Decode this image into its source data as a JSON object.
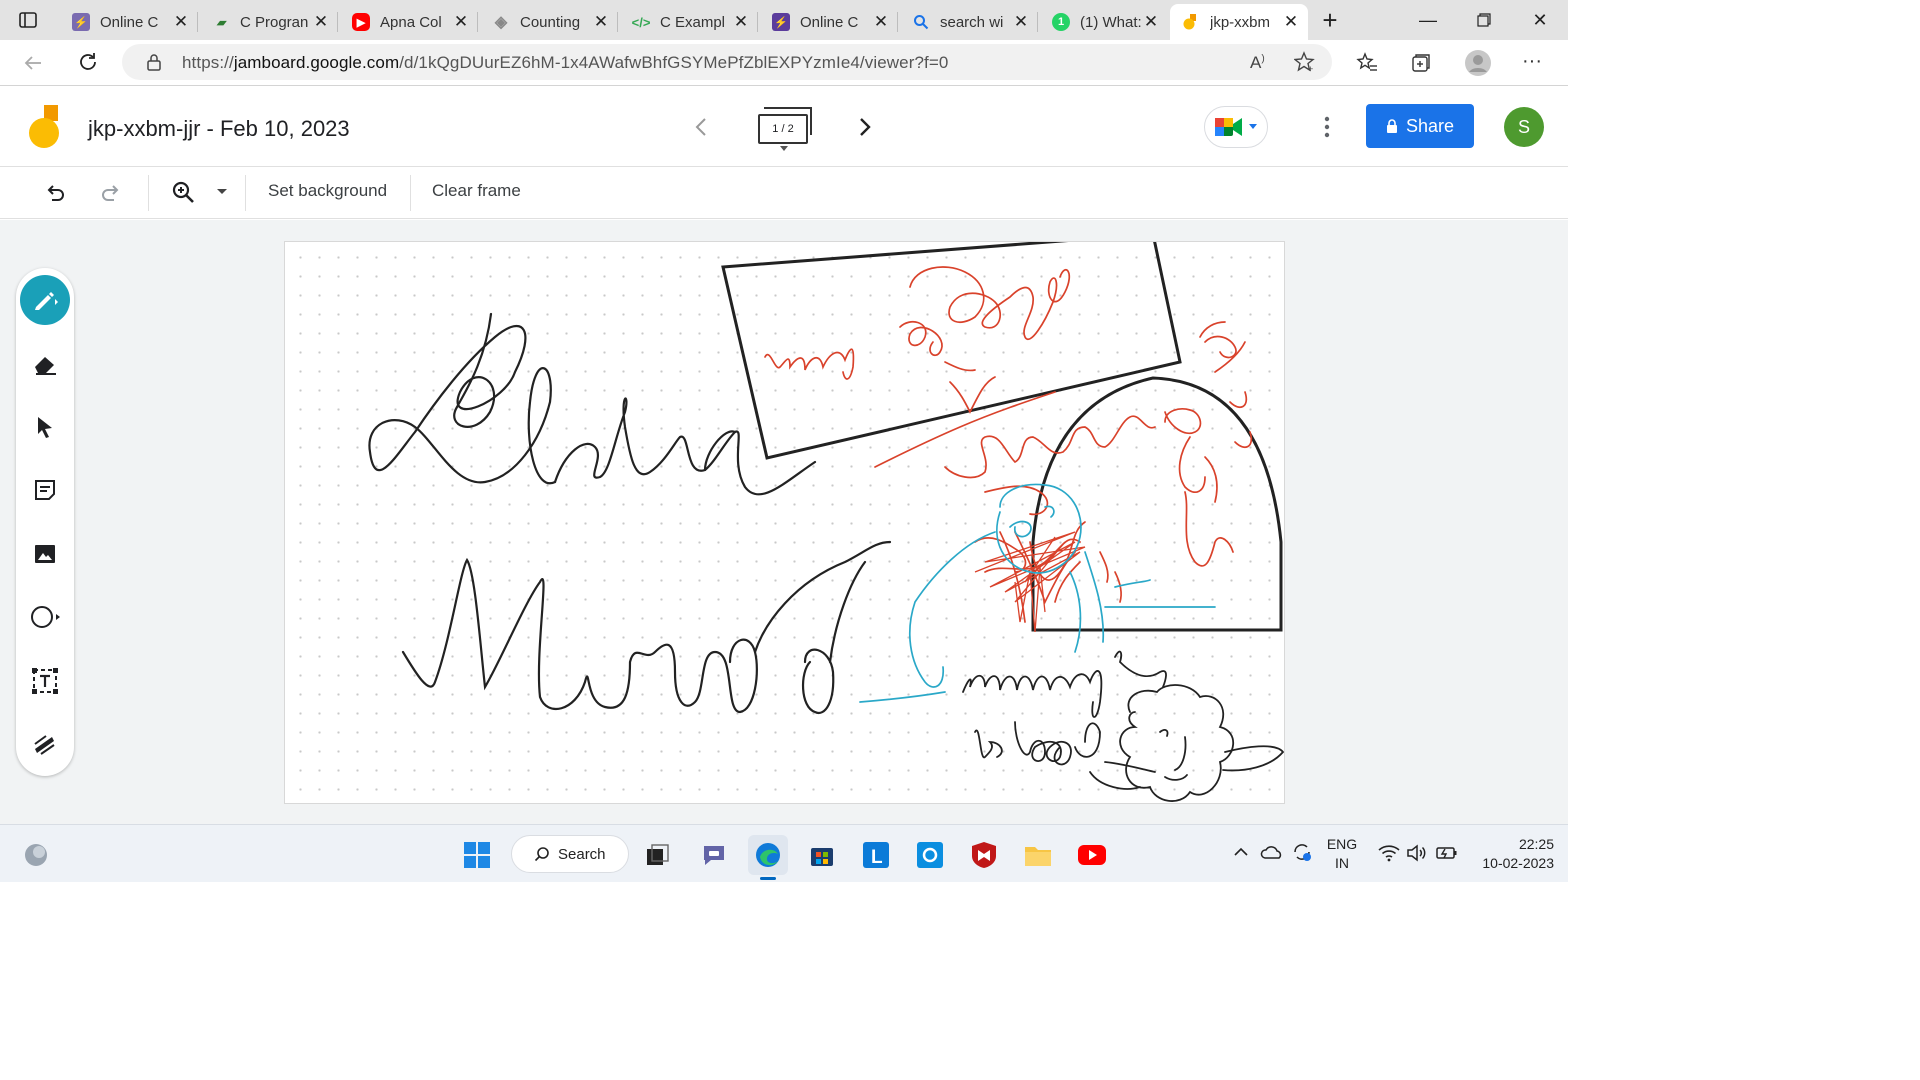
{
  "browser": {
    "tabs": [
      {
        "title": "Online C",
        "fav": "lightning-icon",
        "color": "#6e5ea8"
      },
      {
        "title": "C Progran",
        "fav": "c-logo-icon",
        "color": "#2e7d32"
      },
      {
        "title": "Apna Col",
        "fav": "youtube-icon",
        "color": "#ff0000"
      },
      {
        "title": "Counting",
        "fav": "diamond-icon",
        "color": "#888888"
      },
      {
        "title": "C Exampl",
        "fav": "code-icon",
        "color": "#34a853"
      },
      {
        "title": "Online C",
        "fav": "lightning-icon",
        "color": "#5b3c9c"
      },
      {
        "title": "search wi",
        "fav": "search-icon",
        "color": "#1a73e8"
      },
      {
        "title": "(1) What:",
        "fav": "whatsapp-icon",
        "color": "#25d366"
      },
      {
        "title": "jkp-xxbm",
        "fav": "jamboard-icon",
        "color": "#f9ab00"
      }
    ],
    "url_prefix": "https://",
    "url_host": "jamboard.google.com",
    "url_path": "/d/1kQgDUurEZ6hM-1x4AWafwBhfGSYMePfZblEXPYzmIe4/viewer?f=0"
  },
  "jamboard": {
    "title": "jkp-xxbm-jjr - Feb 10, 2023",
    "frame_indicator": "1 / 2",
    "share_label": "Share",
    "avatar_letter": "S"
  },
  "toolbar": {
    "set_background": "Set background",
    "clear_frame": "Clear frame"
  },
  "taskbar": {
    "search_label": "Search",
    "lang_top": "ENG",
    "lang_bottom": "IN",
    "time": "22:25",
    "date": "10-02-2023"
  },
  "colors": {
    "accent": "#1a73e8",
    "pen_active": "#1aa0b8",
    "ink_black": "#222222",
    "ink_red": "#d9422b",
    "ink_cyan": "#2aa8c8"
  }
}
